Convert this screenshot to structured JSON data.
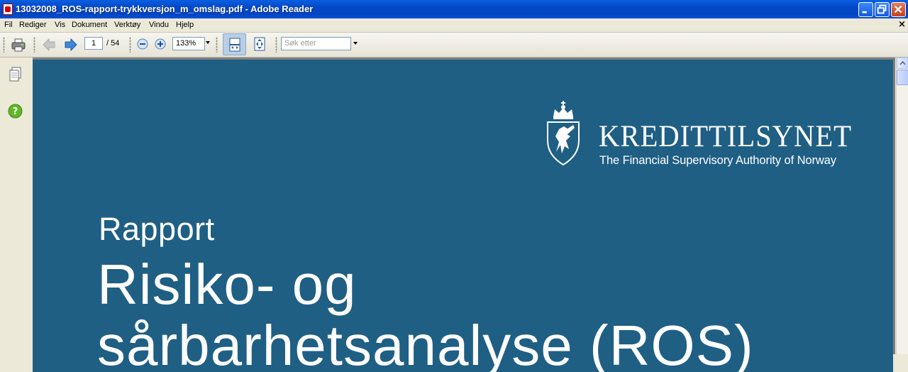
{
  "window": {
    "title": "13032008_ROS-rapport-trykkversjon_m_omslag.pdf - Adobe Reader"
  },
  "menu": {
    "items": [
      "Fil",
      "Rediger",
      "Vis",
      "Dokument",
      "Verktøy",
      "Vindu",
      "Hjelp"
    ],
    "close_glyph": "×"
  },
  "toolbar": {
    "current_page": "1",
    "page_total": "/ 54",
    "zoom": "133%",
    "search_placeholder": "Søk etter"
  },
  "document": {
    "brand_name": "KREDITTILSYNET",
    "brand_subtitle": "The Financial Supervisory Authority of Norway",
    "kicker": "Rapport",
    "title_line_1": "Risiko- og",
    "title_line_2": "sårbarhetsanalyse (ROS)",
    "background_color": "#1f5f84"
  },
  "icons": {
    "print": "print-icon",
    "prev_page": "arrow-left-icon",
    "next_page": "arrow-right-icon",
    "zoom_out": "zoom-out-icon",
    "zoom_in": "zoom-in-icon",
    "fit_width": "fit-width-icon",
    "fit_page": "fit-page-icon",
    "pages_panel": "pages-icon",
    "help": "help-icon"
  }
}
